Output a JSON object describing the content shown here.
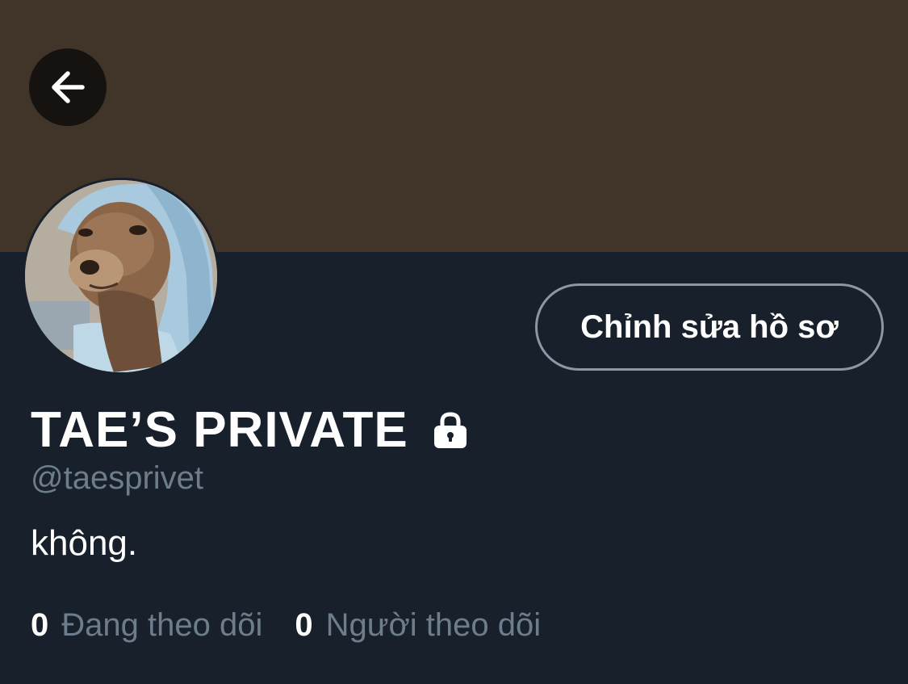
{
  "profile": {
    "display_name": "TAE’S PRIVATE",
    "handle": "@taesprivet",
    "bio": "không.",
    "edit_button_label": "Chỉnh sửa hồ sơ",
    "protected": true
  },
  "stats": {
    "following_count": "0",
    "following_label": "Đang theo dõi",
    "followers_count": "0",
    "followers_label": "Người theo dõi"
  },
  "icons": {
    "back": "arrow-left-icon",
    "lock": "lock-icon"
  },
  "colors": {
    "banner": "#413429",
    "background": "#18202b",
    "secondary_text": "#6e7d8b",
    "button_border": "#8a98a5"
  }
}
